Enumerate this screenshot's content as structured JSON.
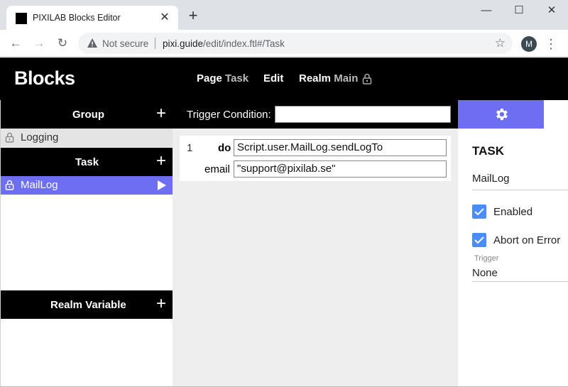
{
  "browser": {
    "tab_title": "PIXILAB Blocks Editor",
    "tab_close_icon": "close-icon",
    "new_tab_icon": "plus-icon",
    "window_controls": {
      "minimize": "—",
      "maximize": "☐",
      "close": "✕"
    },
    "not_secure_label": "Not secure",
    "url_host": "pixi.guide",
    "url_path": "/edit/index.ftl#/Task",
    "profile_initial": "M"
  },
  "header": {
    "logo": "Blocks",
    "page_label": "Page",
    "page_value": "Task",
    "edit_label": "Edit",
    "realm_label": "Realm",
    "realm_value": "Main"
  },
  "sidebar": {
    "group_title": "Group",
    "group_items": [
      {
        "label": "Logging",
        "locked": true
      }
    ],
    "task_title": "Task",
    "task_items": [
      {
        "label": "MailLog",
        "locked": true,
        "selected": true
      }
    ],
    "realm_variable_title": "Realm Variable",
    "add_symbol": "+"
  },
  "main": {
    "trigger_condition_label": "Trigger Condition:",
    "trigger_condition_value": "",
    "code": {
      "line_number": "1",
      "do_keyword": "do",
      "do_value": "Script.user.MailLog.sendLogTo",
      "param_name": "email",
      "param_value": "\"support@pixilab.se\""
    }
  },
  "panel": {
    "heading": "TASK",
    "name_value": "MailLog",
    "enabled_label": "Enabled",
    "enabled_checked": true,
    "abort_label": "Abort on Error",
    "abort_checked": true,
    "trigger_label": "Trigger",
    "trigger_value": "None"
  },
  "colors": {
    "accent": "#6e6ef2",
    "checkbox": "#4b8df8",
    "header_bg": "#000000",
    "main_bg": "#eeeeee"
  }
}
